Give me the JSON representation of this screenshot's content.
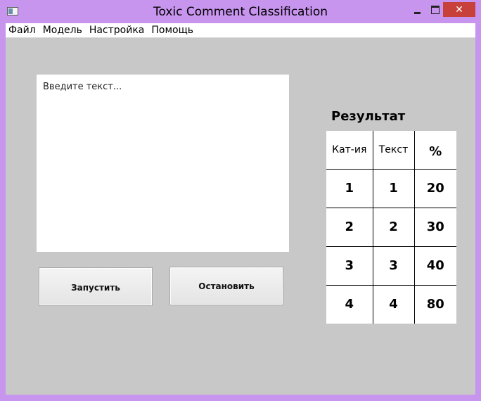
{
  "window": {
    "title": "Toxic Comment Classification",
    "close_glyph": "✕"
  },
  "menu": {
    "items": [
      "Файл",
      "Модель",
      "Настройка",
      "Помощь"
    ]
  },
  "input": {
    "placeholder": "Введите текст..."
  },
  "buttons": {
    "run_label": "Запустить",
    "stop_label": "Остановить"
  },
  "result": {
    "title": "Результат",
    "headers": [
      "Кат-ия",
      "Текст",
      "%"
    ],
    "rows": [
      [
        "1",
        "1",
        "20"
      ],
      [
        "2",
        "2",
        "30"
      ],
      [
        "3",
        "3",
        "40"
      ],
      [
        "4",
        "4",
        "80"
      ]
    ]
  },
  "colors": {
    "window_frame": "#c794ee",
    "client_bg": "#c8c8c8",
    "close_button": "#c7403a"
  }
}
